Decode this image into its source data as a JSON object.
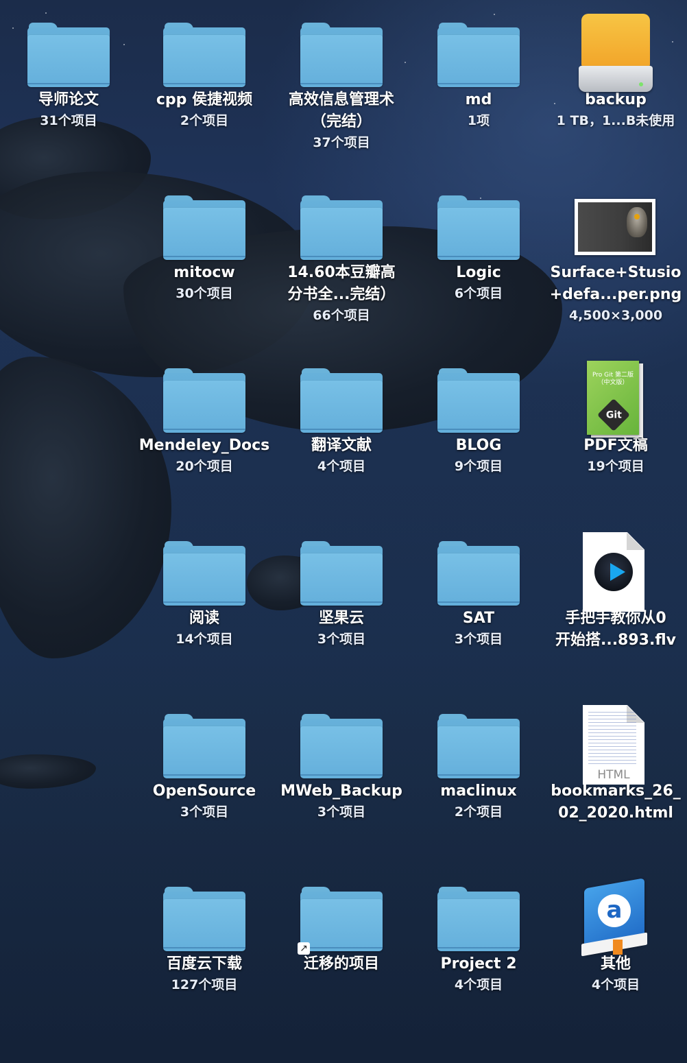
{
  "desktop": {
    "items": [
      {
        "label": "导师论文",
        "sub": "31个项目",
        "icon": "folder-icon"
      },
      {
        "label": "cpp 侯捷视频",
        "sub": "2个项目",
        "icon": "folder-icon"
      },
      {
        "label": "高效信息管理术\n（完结）",
        "sub": "37个项目",
        "icon": "folder-icon"
      },
      {
        "label": "md",
        "sub": "1项",
        "icon": "folder-icon"
      },
      {
        "label": "backup",
        "sub": "1 TB，1...B未使用",
        "icon": "external-drive-icon"
      },
      {
        "label": "mitocw",
        "sub": "30个项目",
        "icon": "folder-icon"
      },
      {
        "label": "14.60本豆瓣高\n分书全...完结）",
        "sub": "66个项目",
        "icon": "folder-icon"
      },
      {
        "label": "Logic",
        "sub": "6个项目",
        "icon": "folder-icon"
      },
      {
        "label": "Surface+Stusio\n+defa...per.png",
        "sub": "4,500×3,000",
        "icon": "image-thumbnail-icon"
      },
      {
        "label": "Mendeley_Docs",
        "sub": "20个项目",
        "icon": "folder-icon"
      },
      {
        "label": "翻译文献",
        "sub": "4个项目",
        "icon": "folder-icon"
      },
      {
        "label": "BLOG",
        "sub": "9个项目",
        "icon": "folder-icon"
      },
      {
        "label": "PDF文稿",
        "sub": "19个项目",
        "icon": "pdf-book-icon"
      },
      {
        "label": "阅读",
        "sub": "14个项目",
        "icon": "folder-icon"
      },
      {
        "label": "坚果云",
        "sub": "3个项目",
        "icon": "folder-icon"
      },
      {
        "label": "SAT",
        "sub": "3个项目",
        "icon": "folder-icon"
      },
      {
        "label": "手把手教你从0\n开始搭...893.flv",
        "sub": "",
        "icon": "video-file-icon"
      },
      {
        "label": "OpenSource",
        "sub": "3个项目",
        "icon": "folder-icon"
      },
      {
        "label": "MWeb_Backup",
        "sub": "3个项目",
        "icon": "folder-icon"
      },
      {
        "label": "maclinux",
        "sub": "2个项目",
        "icon": "folder-icon"
      },
      {
        "label": "bookmarks_26_\n02_2020.html",
        "sub": "",
        "icon": "html-file-icon"
      },
      {
        "label": "百度云下载",
        "sub": "127个项目",
        "icon": "folder-icon"
      },
      {
        "label": "迁移的项目",
        "sub": "",
        "icon": "folder-alias-icon"
      },
      {
        "label": "Project 2",
        "sub": "4个项目",
        "icon": "folder-icon"
      },
      {
        "label": "其他",
        "sub": "4个项目",
        "icon": "dictionary-app-icon"
      }
    ],
    "pdf_cover_text": "Pro Git 第二版\n（中文版）",
    "pdf_cover_logo": "Git",
    "html_ext": "HTML",
    "alias_arrow": "↗",
    "dict_letter": "a"
  }
}
